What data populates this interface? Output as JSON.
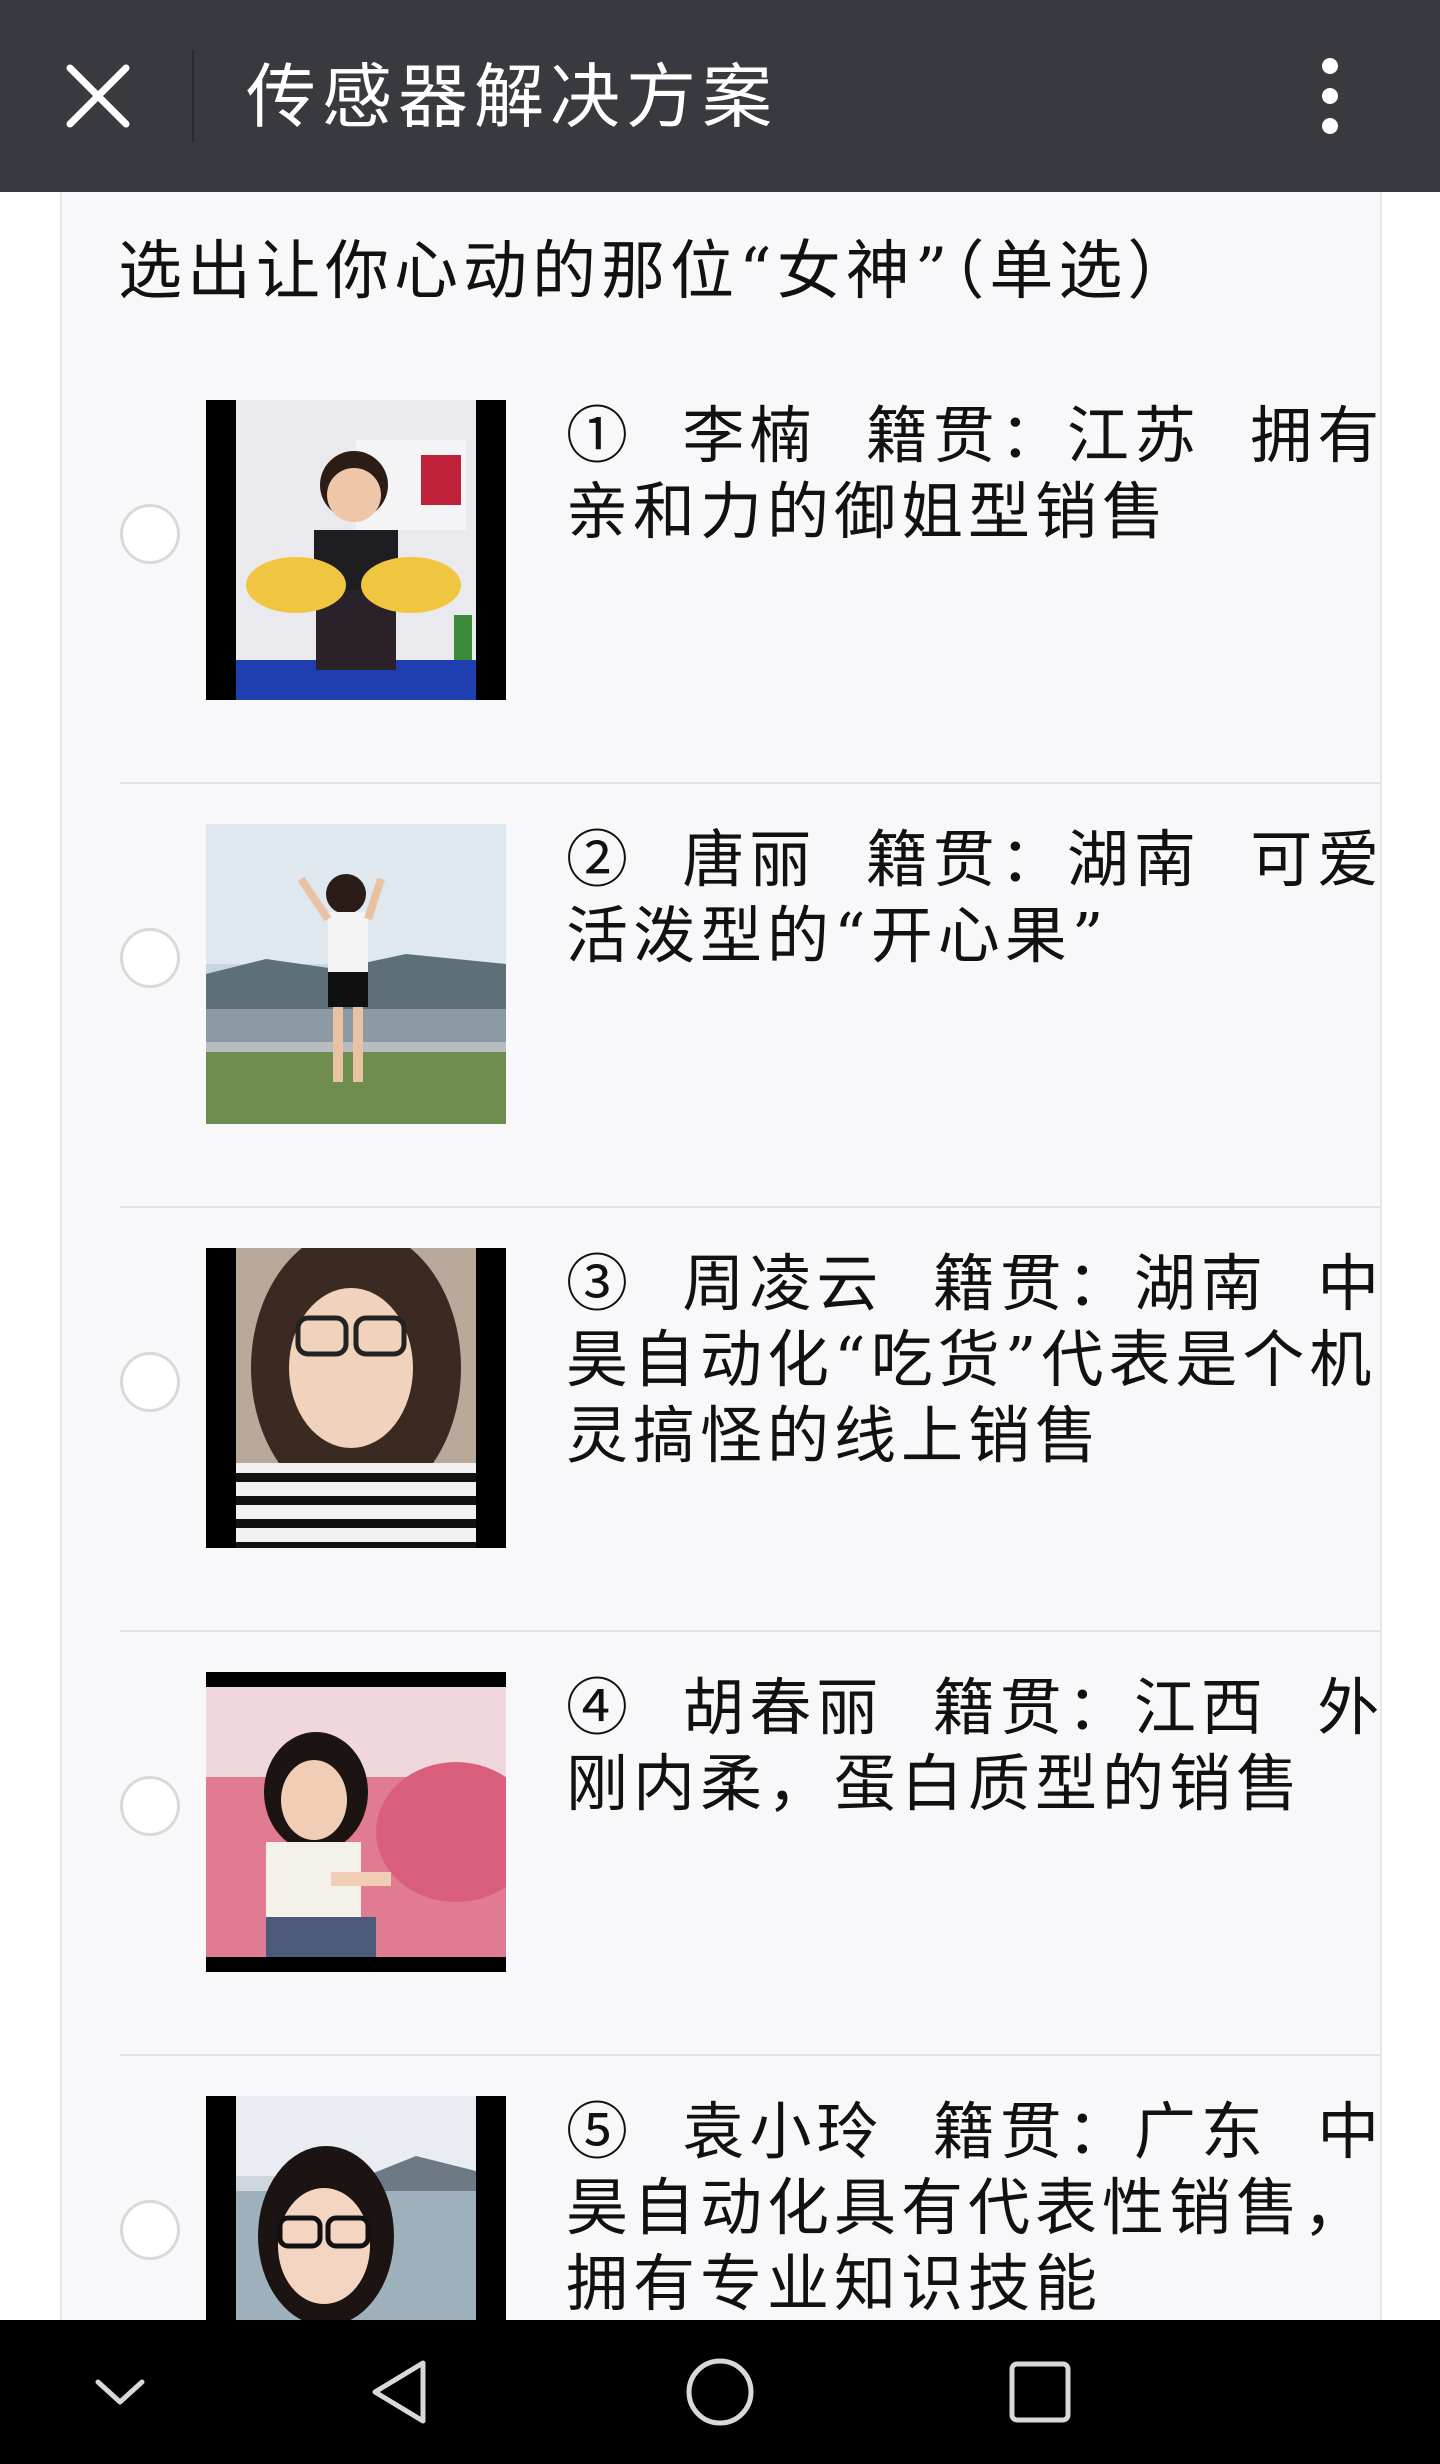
{
  "header": {
    "title": "传感器解决方案",
    "close_icon": "close-icon",
    "more_icon": "more-vertical-icon"
  },
  "survey": {
    "question": "选出让你心动的那位“女神”（单选）",
    "options": [
      {
        "text": "①  李楠  籍贯：江苏  拥有亲和力的御姐型销售",
        "selected": false
      },
      {
        "text": "②  唐丽  籍贯：湖南  可爱活泼型的“开心果”",
        "selected": false
      },
      {
        "text": "③  周凌云  籍贯：湖南  中昊自动化“吃货”代表是个机灵搞怪的线上销售",
        "selected": false
      },
      {
        "text": "④  胡春丽  籍贯：江西  外刚内柔，蛋白质型的销售",
        "selected": false
      },
      {
        "text": "⑤  袁小玲  籍贯：广东  中昊自动化具有代表性销售，拥有专业知识技能",
        "selected": false
      }
    ]
  },
  "navbar": {
    "icons": [
      "chevron-down-icon",
      "back-triangle-icon",
      "home-circle-icon",
      "recents-square-icon"
    ]
  }
}
